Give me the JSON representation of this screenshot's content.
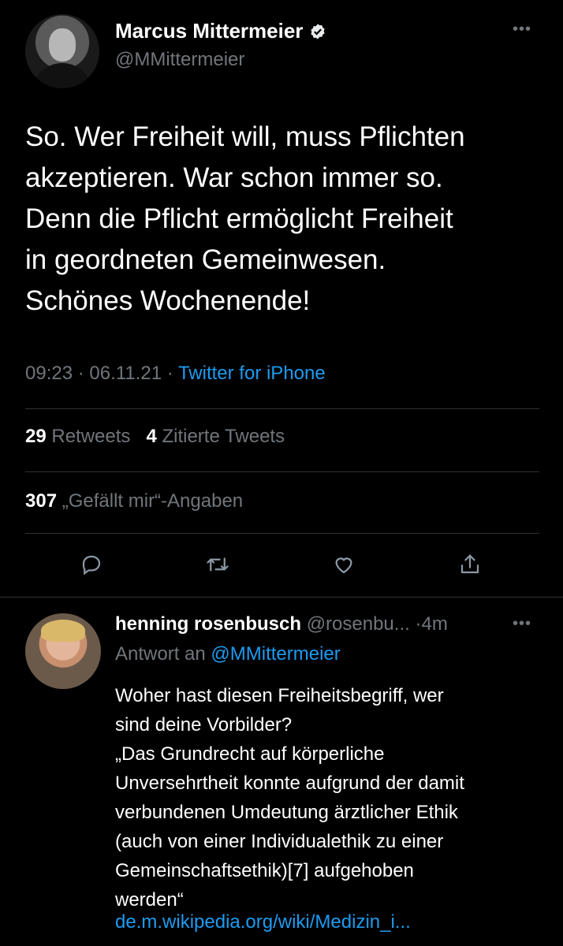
{
  "tweet": {
    "author_name": "Marcus Mittermeier",
    "author_handle": "@MMittermeier",
    "more": "•••",
    "text_lines": [
      "So. Wer Freiheit will, muss Pflichten",
      "akzeptieren. War schon immer so.",
      "Denn die Pflicht ermöglicht Freiheit",
      "in geordneten Gemeinwesen.",
      "Schönes Wochenende!"
    ],
    "time": "09:23",
    "date": "06.11.21",
    "source": "Twitter for iPhone",
    "retweets_count": "29",
    "retweets_label": "Retweets",
    "quotes_count": "4",
    "quotes_label": "Zitierte Tweets",
    "likes_count": "307",
    "likes_label": "„Gefällt mir“-Angaben"
  },
  "reply": {
    "author_name": "henning rosenbusch",
    "author_handle": "@rosenbu...",
    "age": "4m",
    "more": "•••",
    "replying_prefix": "Antwort an",
    "replying_handle": "@MMittermeier",
    "text_lines": [
      "Woher hast diesen Freiheitsbegriff, wer",
      "sind deine Vorbilder?",
      "„Das Grundrecht auf körperliche",
      "Unversehrtheit konnte aufgrund der damit",
      "verbundenen Umdeutung ärztlicher Ethik",
      "(auch von einer Individualethik zu einer",
      "Gemeinschaftsethik)[7] aufgehoben",
      "werden“"
    ],
    "link": "de.m.wikipedia.org/wiki/Medizin_i..."
  },
  "icons": {
    "verified": "verified-badge-icon",
    "reply": "reply-icon",
    "retweet": "retweet-icon",
    "like": "heart-icon",
    "share": "share-icon"
  },
  "colors": {
    "background": "#000000",
    "text": "#e7e9ea",
    "muted": "#71767b",
    "accent": "#1d9bf0",
    "divider": "#2f3336"
  }
}
